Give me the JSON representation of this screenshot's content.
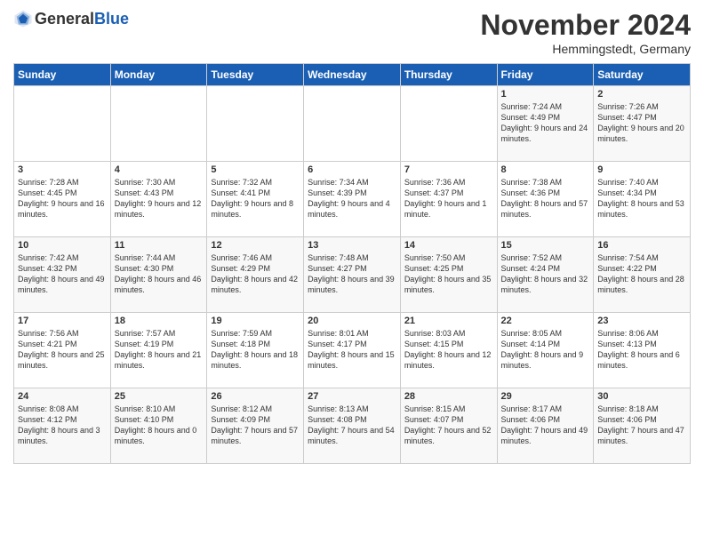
{
  "logo": {
    "text_general": "General",
    "text_blue": "Blue"
  },
  "header": {
    "month_title": "November 2024",
    "location": "Hemmingstedt, Germany"
  },
  "weekdays": [
    "Sunday",
    "Monday",
    "Tuesday",
    "Wednesday",
    "Thursday",
    "Friday",
    "Saturday"
  ],
  "weeks": [
    [
      {
        "day": "",
        "info": ""
      },
      {
        "day": "",
        "info": ""
      },
      {
        "day": "",
        "info": ""
      },
      {
        "day": "",
        "info": ""
      },
      {
        "day": "",
        "info": ""
      },
      {
        "day": "1",
        "info": "Sunrise: 7:24 AM\nSunset: 4:49 PM\nDaylight: 9 hours and 24 minutes."
      },
      {
        "day": "2",
        "info": "Sunrise: 7:26 AM\nSunset: 4:47 PM\nDaylight: 9 hours and 20 minutes."
      }
    ],
    [
      {
        "day": "3",
        "info": "Sunrise: 7:28 AM\nSunset: 4:45 PM\nDaylight: 9 hours and 16 minutes."
      },
      {
        "day": "4",
        "info": "Sunrise: 7:30 AM\nSunset: 4:43 PM\nDaylight: 9 hours and 12 minutes."
      },
      {
        "day": "5",
        "info": "Sunrise: 7:32 AM\nSunset: 4:41 PM\nDaylight: 9 hours and 8 minutes."
      },
      {
        "day": "6",
        "info": "Sunrise: 7:34 AM\nSunset: 4:39 PM\nDaylight: 9 hours and 4 minutes."
      },
      {
        "day": "7",
        "info": "Sunrise: 7:36 AM\nSunset: 4:37 PM\nDaylight: 9 hours and 1 minute."
      },
      {
        "day": "8",
        "info": "Sunrise: 7:38 AM\nSunset: 4:36 PM\nDaylight: 8 hours and 57 minutes."
      },
      {
        "day": "9",
        "info": "Sunrise: 7:40 AM\nSunset: 4:34 PM\nDaylight: 8 hours and 53 minutes."
      }
    ],
    [
      {
        "day": "10",
        "info": "Sunrise: 7:42 AM\nSunset: 4:32 PM\nDaylight: 8 hours and 49 minutes."
      },
      {
        "day": "11",
        "info": "Sunrise: 7:44 AM\nSunset: 4:30 PM\nDaylight: 8 hours and 46 minutes."
      },
      {
        "day": "12",
        "info": "Sunrise: 7:46 AM\nSunset: 4:29 PM\nDaylight: 8 hours and 42 minutes."
      },
      {
        "day": "13",
        "info": "Sunrise: 7:48 AM\nSunset: 4:27 PM\nDaylight: 8 hours and 39 minutes."
      },
      {
        "day": "14",
        "info": "Sunrise: 7:50 AM\nSunset: 4:25 PM\nDaylight: 8 hours and 35 minutes."
      },
      {
        "day": "15",
        "info": "Sunrise: 7:52 AM\nSunset: 4:24 PM\nDaylight: 8 hours and 32 minutes."
      },
      {
        "day": "16",
        "info": "Sunrise: 7:54 AM\nSunset: 4:22 PM\nDaylight: 8 hours and 28 minutes."
      }
    ],
    [
      {
        "day": "17",
        "info": "Sunrise: 7:56 AM\nSunset: 4:21 PM\nDaylight: 8 hours and 25 minutes."
      },
      {
        "day": "18",
        "info": "Sunrise: 7:57 AM\nSunset: 4:19 PM\nDaylight: 8 hours and 21 minutes."
      },
      {
        "day": "19",
        "info": "Sunrise: 7:59 AM\nSunset: 4:18 PM\nDaylight: 8 hours and 18 minutes."
      },
      {
        "day": "20",
        "info": "Sunrise: 8:01 AM\nSunset: 4:17 PM\nDaylight: 8 hours and 15 minutes."
      },
      {
        "day": "21",
        "info": "Sunrise: 8:03 AM\nSunset: 4:15 PM\nDaylight: 8 hours and 12 minutes."
      },
      {
        "day": "22",
        "info": "Sunrise: 8:05 AM\nSunset: 4:14 PM\nDaylight: 8 hours and 9 minutes."
      },
      {
        "day": "23",
        "info": "Sunrise: 8:06 AM\nSunset: 4:13 PM\nDaylight: 8 hours and 6 minutes."
      }
    ],
    [
      {
        "day": "24",
        "info": "Sunrise: 8:08 AM\nSunset: 4:12 PM\nDaylight: 8 hours and 3 minutes."
      },
      {
        "day": "25",
        "info": "Sunrise: 8:10 AM\nSunset: 4:10 PM\nDaylight: 8 hours and 0 minutes."
      },
      {
        "day": "26",
        "info": "Sunrise: 8:12 AM\nSunset: 4:09 PM\nDaylight: 7 hours and 57 minutes."
      },
      {
        "day": "27",
        "info": "Sunrise: 8:13 AM\nSunset: 4:08 PM\nDaylight: 7 hours and 54 minutes."
      },
      {
        "day": "28",
        "info": "Sunrise: 8:15 AM\nSunset: 4:07 PM\nDaylight: 7 hours and 52 minutes."
      },
      {
        "day": "29",
        "info": "Sunrise: 8:17 AM\nSunset: 4:06 PM\nDaylight: 7 hours and 49 minutes."
      },
      {
        "day": "30",
        "info": "Sunrise: 8:18 AM\nSunset: 4:06 PM\nDaylight: 7 hours and 47 minutes."
      }
    ]
  ]
}
